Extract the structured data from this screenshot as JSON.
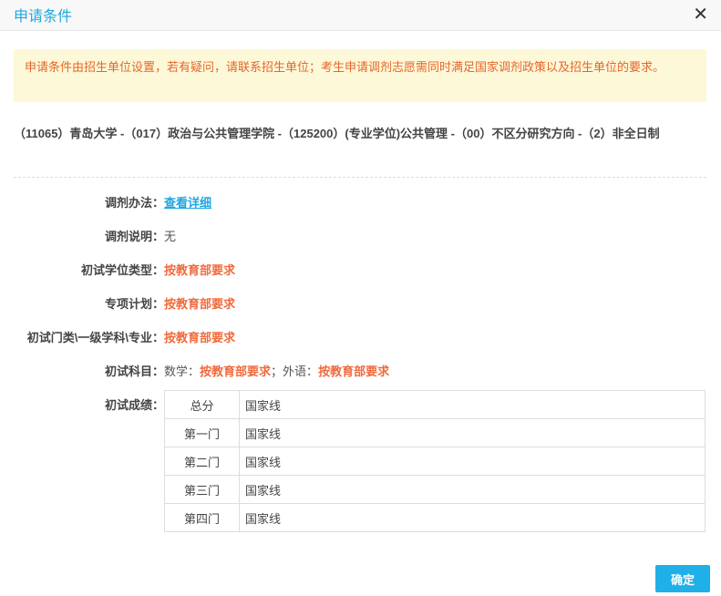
{
  "dialog": {
    "title": "申请条件",
    "close_icon": "close-icon"
  },
  "notice": "申请条件由招生单位设置，若有疑问，请联系招生单位；考生申请调剂志愿需同时满足国家调剂政策以及招生单位的要求。",
  "program": "（11065）青岛大学 -（017）政治与公共管理学院 -（125200）(专业学位)公共管理 -（00）不区分研究方向 -（2）非全日制",
  "fields": {
    "method_label": "调剂办法：",
    "method_link": "查看详细",
    "desc_label": "调剂说明：",
    "desc_value": "无",
    "degree_label": "初试学位类型：",
    "degree_value": "按教育部要求",
    "plan_label": "专项计划：",
    "plan_value": "按教育部要求",
    "major_label": "初试门类\\一级学科\\专业：",
    "major_value": "按教育部要求",
    "subject_label": "初试科目：",
    "math_label": "数学：",
    "math_value": "按教育部要求",
    "sep": "；",
    "lang_label": "外语：",
    "lang_value": "按教育部要求",
    "score_label": "初试成绩："
  },
  "scores": [
    {
      "name": "总分",
      "value": "国家线"
    },
    {
      "name": "第一门",
      "value": "国家线"
    },
    {
      "name": "第二门",
      "value": "国家线"
    },
    {
      "name": "第三门",
      "value": "国家线"
    },
    {
      "name": "第四门",
      "value": "国家线"
    }
  ],
  "confirm_label": "确定",
  "colors": {
    "accent": "#1fa6e0",
    "highlight": "#f06a3c",
    "notice_bg": "#fdf8d7"
  }
}
